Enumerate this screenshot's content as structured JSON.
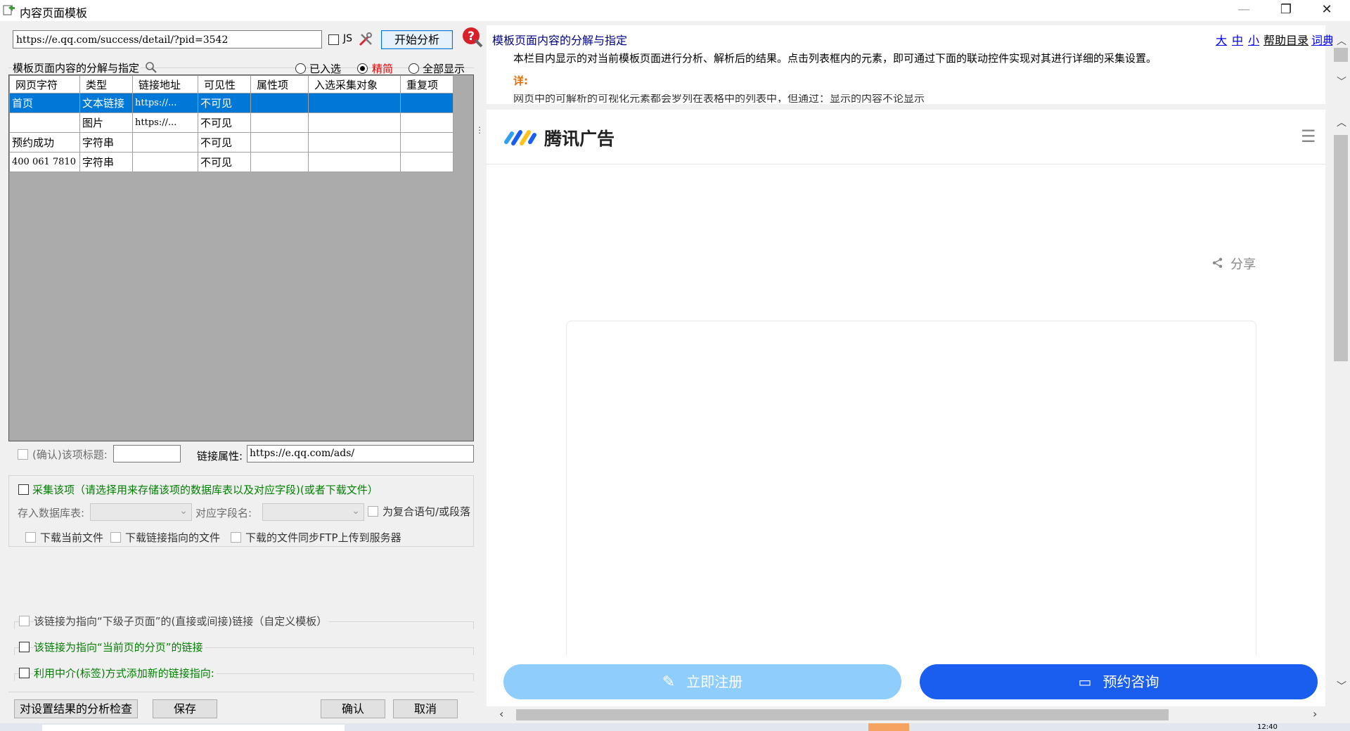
{
  "window": {
    "title": "内容页面模板",
    "minimize": "—",
    "restore": "❐",
    "close": "✕"
  },
  "toolbar": {
    "url": "https://e.qq.com/success/detail/?pid=3542",
    "js_label": "JS",
    "analyze_label": "开始分析"
  },
  "template_section": {
    "title": "模板页面内容的分解与指定",
    "filter_options": [
      {
        "label": "已入选",
        "selected": false
      },
      {
        "label": "精简",
        "selected": true
      },
      {
        "label": "全部显示",
        "selected": false
      }
    ]
  },
  "grid": {
    "columns": [
      "网页字符",
      "类型",
      "链接地址",
      "可见性",
      "属性项",
      "入选采集对象",
      "重复项"
    ],
    "rows": [
      {
        "text": "首页",
        "type": "文本链接",
        "link": "https://...",
        "visibility": "不可见",
        "attr": "",
        "selected_obj": "",
        "repeat": ""
      },
      {
        "text": "",
        "type": "图片",
        "link": "https://...",
        "visibility": "不可见",
        "attr": "",
        "selected_obj": "",
        "repeat": ""
      },
      {
        "text": "预约成功",
        "type": "字符串",
        "link": "",
        "visibility": "不可见",
        "attr": "",
        "selected_obj": "",
        "repeat": ""
      },
      {
        "text": "400 061 7810",
        "type": "字符串",
        "link": "",
        "visibility": "不可见",
        "attr": "",
        "selected_obj": "",
        "repeat": ""
      }
    ]
  },
  "item_props": {
    "confirm_title_label": "(确认)该项标题:",
    "title_value": "",
    "link_attr_label": "链接属性:",
    "link_attr_value": "https://e.qq.com/ads/"
  },
  "collect": {
    "label": "采集该项（请选择用来存储该项的数据库表以及对应字段)(或者下载文件）",
    "db_table_label": "存入数据库表:",
    "field_label": "对应字段名:",
    "compound_label": "为复合语句/或段落",
    "download_current": "下载当前文件",
    "download_link": "下载链接指向的文件",
    "download_ftp": "下载的文件同步FTP上传到服务器"
  },
  "link_options": {
    "sub_page": "该链接为指向“下级子页面”的(直接或间接)链接（自定义模板）",
    "pagination": "该链接为指向“当前页的分页”的链接",
    "intermediary": "利用中介(标签)方式添加新的链接指向:"
  },
  "footer": {
    "check_label": "对设置结果的分析检查",
    "save_label": "保存",
    "ok_label": "确认",
    "cancel_label": "取消"
  },
  "help": {
    "title": "模板页面内容的分解与指定",
    "sizes": [
      "大",
      "中",
      "小"
    ],
    "help_index": "帮助目录",
    "dictionary": "词典",
    "line1": "本栏目内显示的对当前模板页面进行分析、解析后的结果。点击列表框内的元素，即可通过下面的联动控件实现对其进行详细的采集设置。",
    "detail_label": "详:",
    "line2": "网页中的可解析的可视化元素都会罗列在表格中的列表中，但通过：显示的内容不论显示"
  },
  "webpage": {
    "brand": "腾讯广告",
    "share": "分享",
    "register_btn": "立即注册",
    "consult_btn": "预约咨询"
  },
  "taskbar": {
    "clock": "12:40"
  },
  "colors": {
    "accent": "#0078d7",
    "register": "#8fcdfc",
    "consult": "#1a5ef0",
    "selection": "#0078d7"
  }
}
